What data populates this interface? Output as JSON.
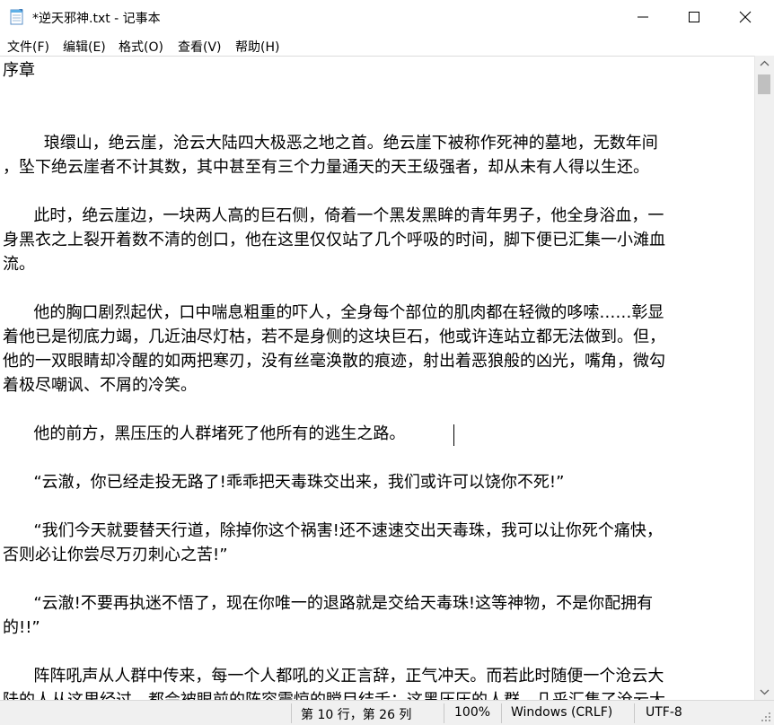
{
  "window": {
    "title": "*逆天邪神.txt - 记事本",
    "icons": {
      "app": "notepad-icon",
      "minimize": "minimize-icon",
      "maximize": "maximize-icon",
      "close": "close-icon"
    }
  },
  "menu": [
    {
      "label": "文件(F)"
    },
    {
      "label": "编辑(E)"
    },
    {
      "label": "格式(O)"
    },
    {
      "label": "查看(V)"
    },
    {
      "label": "帮助(H)"
    }
  ],
  "document": {
    "lines": [
      "序章",
      "",
      "",
      "        琅缳山，绝云崖，沧云大陆四大极恶之地之首。绝云崖下被称作死神的墓地，无数年间",
      "，坠下绝云崖者不计其数，其中甚至有三个力量通天的天王级强者，却从未有人得以生还。",
      "",
      "      此时，绝云崖边，一块两人高的巨石侧，倚着一个黑发黑眸的青年男子，他全身浴血，一",
      "身黑衣之上裂开着数不清的创口，他在这里仅仅站了几个呼吸的时间，脚下便已汇集一小滩血",
      "流。",
      "",
      "      他的胸口剧烈起伏，口中喘息粗重的吓人，全身每个部位的肌肉都在轻微的哆嗦……彰显",
      "着他已是彻底力竭，几近油尽灯枯，若不是身侧的这块巨石，他或许连站立都无法做到。但，",
      "他的一双眼睛却冷醒的如两把寒刃，没有丝毫涣散的痕迹，射出着恶狼般的凶光，嘴角，微勾",
      "着极尽嘲讽、不屑的冷笑。",
      "",
      "      他的前方，黑压压的人群堵死了他所有的逃生之路。",
      "",
      "      “云澈，你已经走投无路了!乖乖把天毒珠交出来，我们或许可以饶你不死!”",
      "",
      "      “我们今天就要替天行道，除掉你这个祸害!还不速速交出天毒珠，我可以让你死个痛快，",
      "否则必让你尝尽万刃刺心之苦!”",
      "",
      "      “云澈!不要再执迷不悟了，现在你唯一的退路就是交给天毒珠!这等神物，不是你配拥有",
      "的!!”",
      "",
      "      阵阵吼声从人群中传来，每一个人都吼的义正言辞，正气冲天。而若此时随便一个沧云大",
      "陆的人从这里经过，都会被眼前的阵容震惊的瞠目结舌：这黑压压的人群，几乎汇集了沧云大"
    ]
  },
  "status": {
    "position": "第 10 行，第 26 列",
    "zoom": "100%",
    "line_ending": "Windows (CRLF)",
    "encoding": "UTF-8"
  }
}
